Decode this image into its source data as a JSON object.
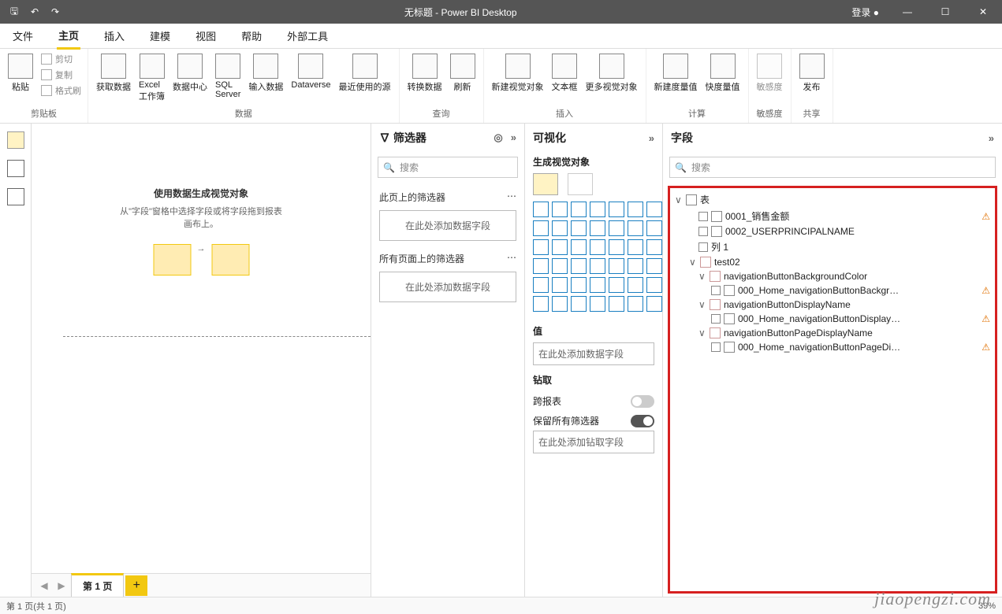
{
  "title": "无标题 - Power BI Desktop",
  "login": "登录",
  "tabs": [
    "文件",
    "主页",
    "插入",
    "建模",
    "视图",
    "帮助",
    "外部工具"
  ],
  "active_tab": 1,
  "ribbon": {
    "clipboard": {
      "label": "剪贴板",
      "paste": "粘贴",
      "cut": "剪切",
      "copy": "复制",
      "fmt": "格式刷"
    },
    "data": {
      "label": "数据",
      "items": [
        "获取数据",
        "Excel 工作簿",
        "数据中心",
        "SQL Server",
        "输入数据",
        "Dataverse",
        "最近使用的源"
      ]
    },
    "query": {
      "label": "查询",
      "items": [
        "转换数据",
        "刷新"
      ]
    },
    "insert": {
      "label": "插入",
      "items": [
        "新建视觉对象",
        "文本框",
        "更多视觉对象"
      ]
    },
    "calc": {
      "label": "计算",
      "items": [
        "新建度量值",
        "快度量值"
      ]
    },
    "sens": {
      "label": "敏感度",
      "item": "敏感度"
    },
    "share": {
      "label": "共享",
      "item": "发布"
    }
  },
  "canvas": {
    "title": "使用数据生成视觉对象",
    "hint": "从\"字段\"窗格中选择字段或将字段拖到报表画布上。"
  },
  "filters": {
    "title": "筛选器",
    "search_placeholder": "搜索",
    "sec1": "此页上的筛选器",
    "drop": "在此处添加数据字段",
    "sec2": "所有页面上的筛选器"
  },
  "viz": {
    "title": "可视化",
    "subtitle": "生成视觉对象",
    "value": "值",
    "value_drop": "在此处添加数据字段",
    "drill": "钻取",
    "cross": "跨报表",
    "keep_filters": "保留所有筛选器",
    "drill_drop": "在此处添加钻取字段"
  },
  "fields": {
    "title": "字段",
    "search_placeholder": "搜索",
    "table": "表",
    "items": [
      {
        "name": "0001_销售金额",
        "indent": 2,
        "chk": true,
        "warn": true,
        "ficon": true
      },
      {
        "name": "0002_USERPRINCIPALNAME",
        "indent": 2,
        "chk": true,
        "ficon": true
      },
      {
        "name": "列 1",
        "indent": 2,
        "chk": true
      },
      {
        "name": "test02",
        "indent": 1,
        "caret": "∨",
        "folder": true
      },
      {
        "name": "navigationButtonBackgroundColor",
        "indent": 2,
        "caret": "∨",
        "folder": true
      },
      {
        "name": "000_Home_navigationButtonBackgr…",
        "indent": 3,
        "chk": true,
        "warn": true,
        "ficon": true
      },
      {
        "name": "navigationButtonDisplayName",
        "indent": 2,
        "caret": "∨",
        "folder": true
      },
      {
        "name": "000_Home_navigationButtonDisplay…",
        "indent": 3,
        "chk": true,
        "warn": true,
        "ficon": true
      },
      {
        "name": "navigationButtonPageDisplayName",
        "indent": 2,
        "caret": "∨",
        "folder": true
      },
      {
        "name": "000_Home_navigationButtonPageDi…",
        "indent": 3,
        "chk": true,
        "warn": true,
        "ficon": true
      }
    ]
  },
  "pages": {
    "active": "第 1 页",
    "status": "第 1 页(共 1 页)"
  },
  "watermark": "jiaopengzi.com",
  "zoom": "39%"
}
